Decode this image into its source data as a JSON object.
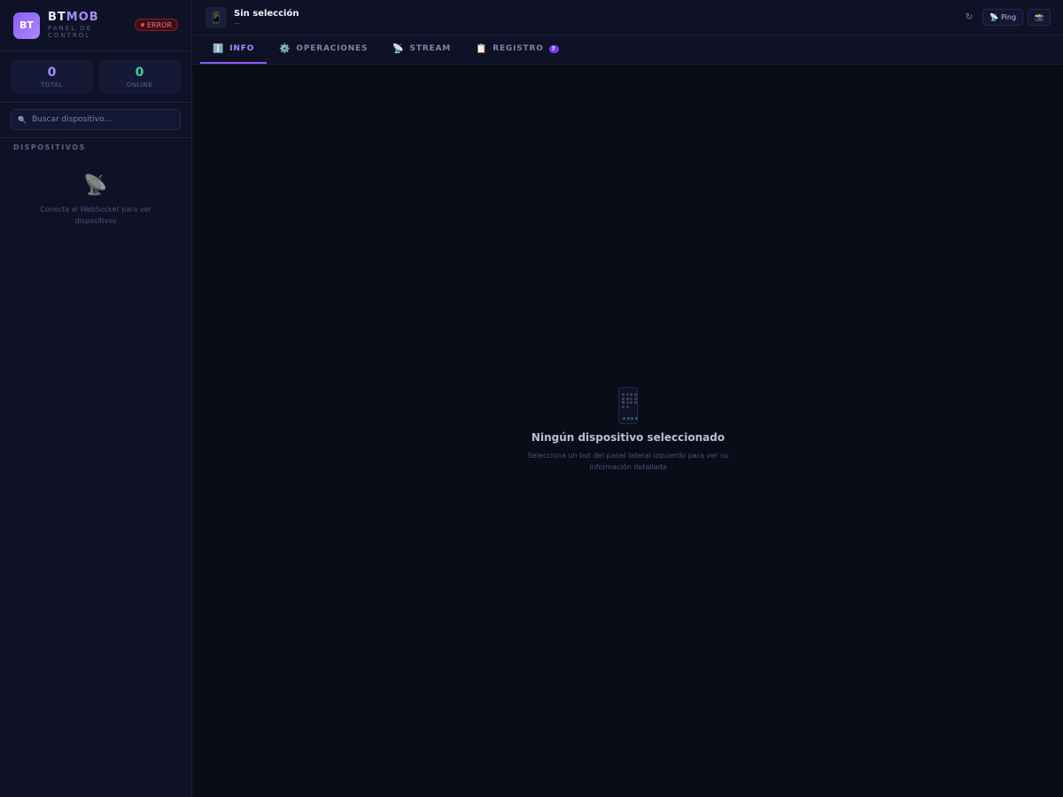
{
  "brand": {
    "logo_text": "BT",
    "name_a": "BT",
    "name_b": "MOB",
    "subtitle": "PANEL DE CONTROL",
    "status_badge": "ERROR"
  },
  "stats": [
    {
      "value": "0",
      "label": "TOTAL",
      "color": "#a78bfa"
    },
    {
      "value": "0",
      "label": "ONLINE",
      "color": "#34d399"
    }
  ],
  "search": {
    "icon": "search-icon",
    "placeholder": "Buscar dispositivo..."
  },
  "sidebar": {
    "section_label": "DISPOSITIVOS",
    "empty_icon": "satellite-icon",
    "empty_text": "Conecta el WebSocket para ver dispositivos"
  },
  "topbar": {
    "device_icon": "phone-icon",
    "device_name": "Sin selección",
    "device_sub": "—",
    "refresh_icon": "↻",
    "ping_label": "Ping",
    "ping_icon": "📡",
    "screenshot_icon": "📸"
  },
  "tabs": [
    {
      "icon": "ℹ️",
      "label": "INFO",
      "active": true
    },
    {
      "icon": "⚙️",
      "label": "OPERACIONES",
      "active": false
    },
    {
      "icon": "📡",
      "label": "STREAM",
      "active": false
    },
    {
      "icon": "📋",
      "label": "REGISTRO",
      "badge": "7",
      "active": false
    }
  ],
  "empty_state": {
    "title": "Ningún dispositivo seleccionado",
    "description": "Selecciona un bot del panel lateral izquierdo para ver su información detallada"
  },
  "colors": {
    "accent": "#8b5cf6",
    "online": "#34d399",
    "error": "#ef4444"
  }
}
